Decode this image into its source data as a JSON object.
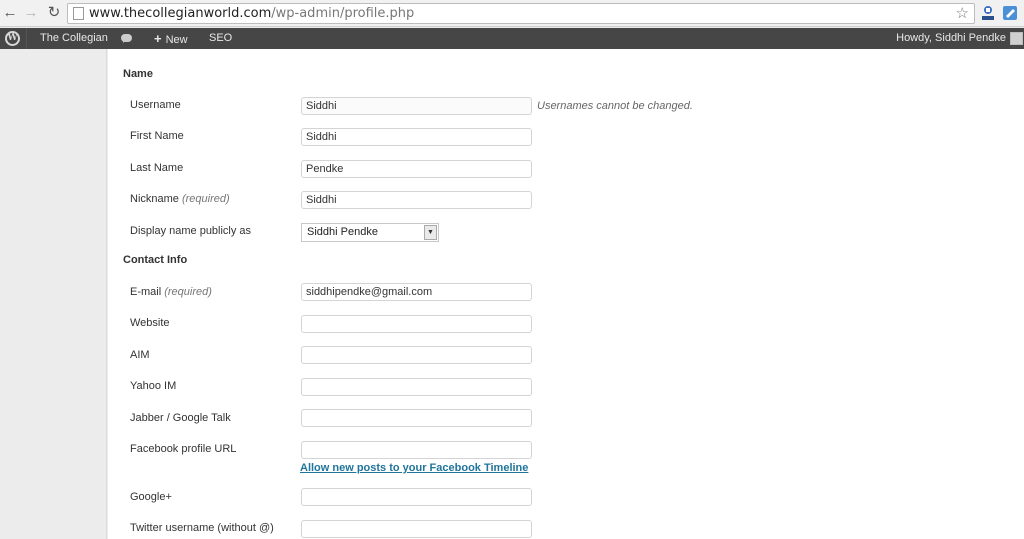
{
  "browser": {
    "back_glyph": "←",
    "forward_glyph": "→",
    "reload_glyph": "↻",
    "url_host": "www.thecollegianworld.com",
    "url_path": "/wp-admin/profile.php",
    "star_glyph": "☆"
  },
  "adminbar": {
    "wp_logo": "W",
    "site_name": "The Collegian",
    "new_plus": "+",
    "new_label": "New",
    "seo_label": "SEO",
    "howdy": "Howdy, Siddhi Pendke"
  },
  "name_section": {
    "title": "Name",
    "username": {
      "label": "Username",
      "value": "Siddhi",
      "hint": "Usernames cannot be changed."
    },
    "first_name": {
      "label": "First Name",
      "value": "Siddhi"
    },
    "last_name": {
      "label": "Last Name",
      "value": "Pendke"
    },
    "nickname": {
      "label": "Nickname",
      "required": "(required)",
      "value": "Siddhi"
    },
    "display_name": {
      "label": "Display name publicly as",
      "value": "Siddhi Pendke",
      "arrow": "▼"
    }
  },
  "contact_section": {
    "title": "Contact Info",
    "email": {
      "label": "E-mail",
      "required": "(required)",
      "value": "siddhipendke@gmail.com"
    },
    "website": {
      "label": "Website",
      "value": ""
    },
    "aim": {
      "label": "AIM",
      "value": ""
    },
    "yahoo": {
      "label": "Yahoo IM",
      "value": ""
    },
    "jabber": {
      "label": "Jabber / Google Talk",
      "value": ""
    },
    "facebook": {
      "label": "Facebook profile URL",
      "value": "",
      "link": "Allow new posts to your Facebook Timeline"
    },
    "googleplus": {
      "label": "Google+",
      "value": ""
    },
    "twitter": {
      "label": "Twitter username (without @)",
      "value": ""
    }
  },
  "colors": {
    "adminbar_bg": "#464646",
    "link": "#21759b",
    "content_bg": "#ffffff",
    "sidebar_bg": "#ececec"
  }
}
